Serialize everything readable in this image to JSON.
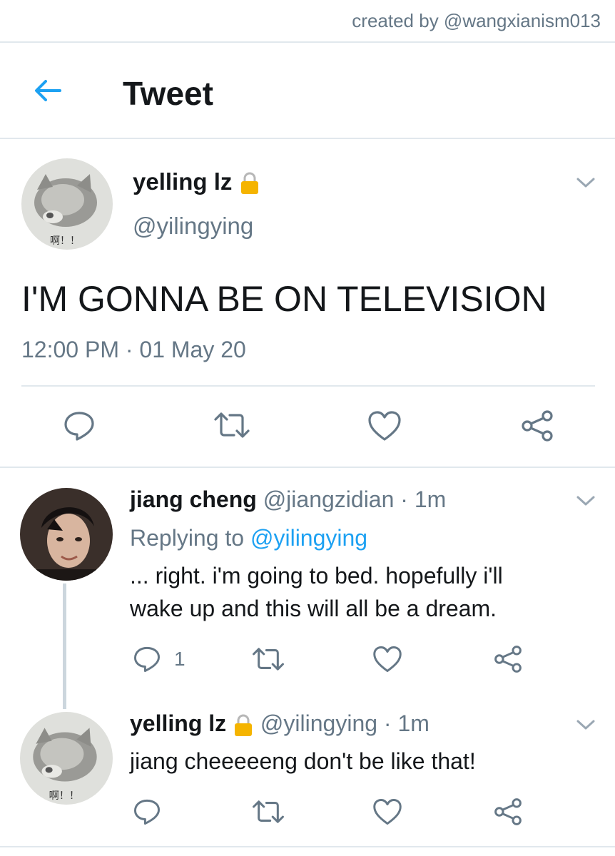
{
  "credit": "created by @wangxianism013",
  "header": {
    "title": "Tweet",
    "back_icon": "arrow-left-icon"
  },
  "colors": {
    "accent": "#1da1f2",
    "muted": "#657786",
    "divider": "#e1e8ed",
    "lock": "#f5b400"
  },
  "main_tweet": {
    "display_name": "yelling lz",
    "handle": "@yilingying",
    "text": "I'M GONNA BE ON TELEVISION",
    "timestamp": "12:00 PM · 01 May 20",
    "avatar_caption": "啊！！",
    "actions": [
      "reply-icon",
      "retweet-icon",
      "like-icon",
      "share-icon"
    ]
  },
  "replies": [
    {
      "display_name": "jiang cheng",
      "handle": "@jiangzidian",
      "time": "· 1m",
      "replying_prefix": "Replying to",
      "replying_to": "@yilingying",
      "text_line1": "... right. i'm going to bed. hopefully i'll",
      "text_line2": "wake up and this will all be a dream.",
      "reply_count": "1"
    },
    {
      "display_name": "yelling lz",
      "handle": "@yilingying",
      "time": "· 1m",
      "text": "jiang cheeeeeng don't be like that!",
      "avatar_caption": "啊！！"
    }
  ]
}
